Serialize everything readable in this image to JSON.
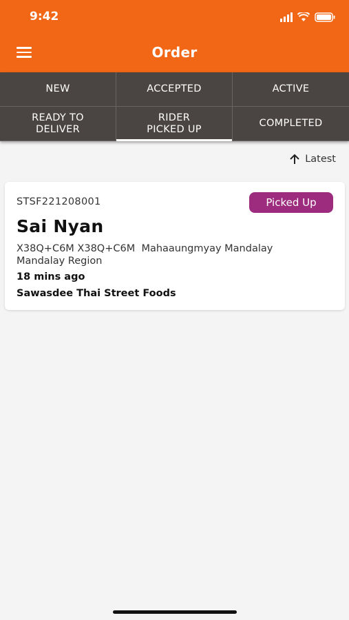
{
  "status_bar": {
    "time": "9:42"
  },
  "header": {
    "title": "Order"
  },
  "tabs": [
    {
      "label": "NEW"
    },
    {
      "label": "ACCEPTED"
    },
    {
      "label": "ACTIVE"
    },
    {
      "label": "READY TO\nDELIVER"
    },
    {
      "label": "RIDER\nPICKED UP"
    },
    {
      "label": "COMPLETED"
    }
  ],
  "active_tab": "RIDER PICKED UP",
  "sort": {
    "label": "Latest"
  },
  "orders": [
    {
      "id": "STSF221208001",
      "status": "Picked Up",
      "customer": "Sai Nyan",
      "address": "X38Q+C6M X38Q+C6M  Mahaaungmyay Mandalay\nMandalay Region",
      "time_ago": "18 mins ago",
      "shop": "Sawasdee Thai Street Foods"
    }
  ],
  "colors": {
    "header_bg": "#f26716",
    "tab_bg": "#4a4442",
    "badge_bg": "#9e2c7e",
    "page_bg": "#f4f4f4"
  }
}
